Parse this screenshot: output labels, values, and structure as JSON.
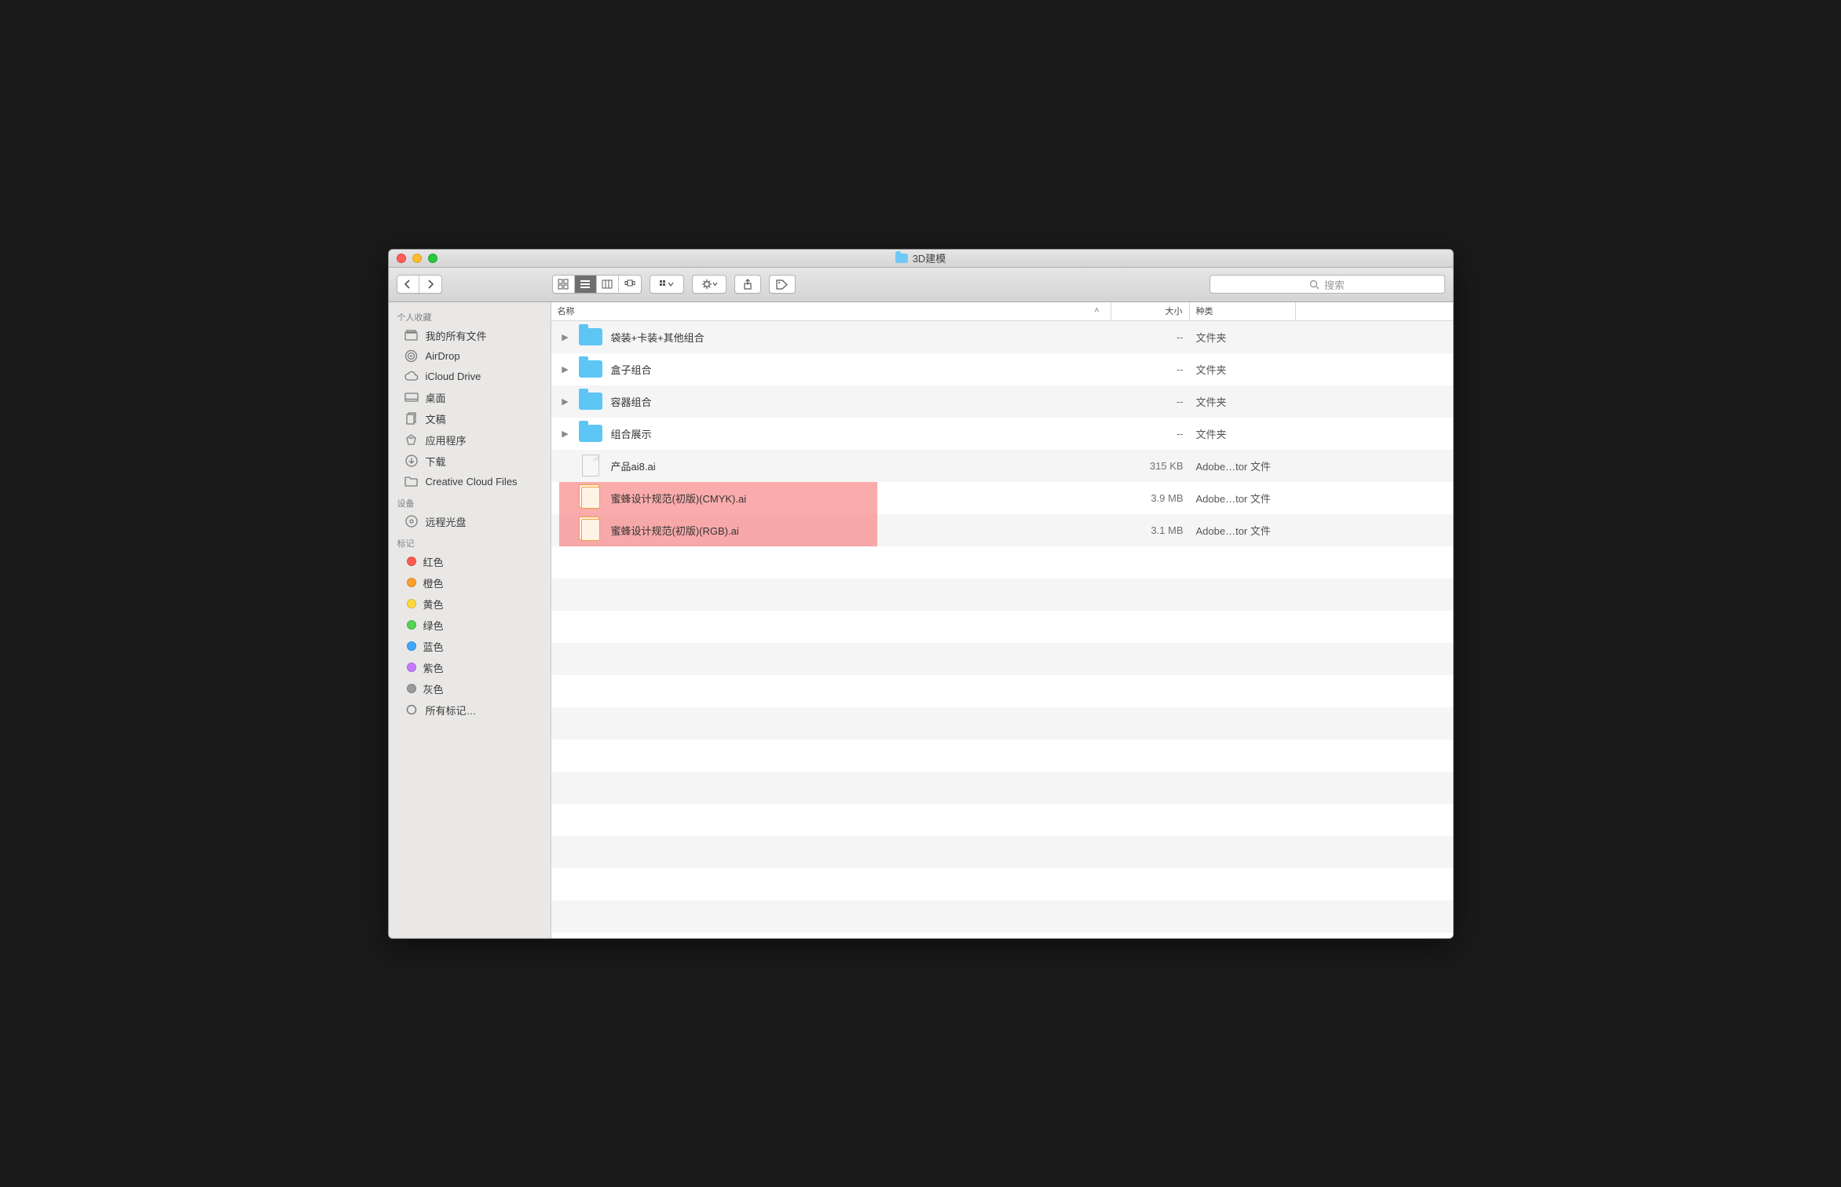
{
  "window": {
    "title": "3D建模"
  },
  "search": {
    "placeholder": "搜索"
  },
  "sidebar": {
    "groups": [
      {
        "label": "个人收藏",
        "items": [
          {
            "label": "我的所有文件"
          },
          {
            "label": "AirDrop"
          },
          {
            "label": "iCloud Drive"
          },
          {
            "label": "桌面"
          },
          {
            "label": "文稿"
          },
          {
            "label": "应用程序"
          },
          {
            "label": "下载"
          },
          {
            "label": "Creative Cloud Files"
          }
        ]
      },
      {
        "label": "设备",
        "items": [
          {
            "label": "远程光盘"
          }
        ]
      },
      {
        "label": "标记",
        "items": [
          {
            "label": "红色",
            "color": "#ff5b4f"
          },
          {
            "label": "橙色",
            "color": "#ff9e2c"
          },
          {
            "label": "黄色",
            "color": "#ffd93b"
          },
          {
            "label": "绿色",
            "color": "#54d454"
          },
          {
            "label": "蓝色",
            "color": "#3ea7ff"
          },
          {
            "label": "紫色",
            "color": "#c57bff"
          },
          {
            "label": "灰色",
            "color": "#9b9b9b"
          },
          {
            "label": "所有标记…",
            "color": null
          }
        ]
      }
    ]
  },
  "columns": {
    "name": "名称",
    "size": "大小",
    "kind": "种类"
  },
  "rows": [
    {
      "name": "袋装+卡装+其他组合",
      "size": "--",
      "kind": "文件夹",
      "type": "folder"
    },
    {
      "name": "盒子组合",
      "size": "--",
      "kind": "文件夹",
      "type": "folder"
    },
    {
      "name": "容器组合",
      "size": "--",
      "kind": "文件夹",
      "type": "folder"
    },
    {
      "name": "组合展示",
      "size": "--",
      "kind": "文件夹",
      "type": "folder"
    },
    {
      "name": "产品ai8.ai",
      "size": "315 KB",
      "kind": "Adobe…tor 文件",
      "type": "doc"
    },
    {
      "name": "蜜蜂设计规范(初版)(CMYK).ai",
      "size": "3.9 MB",
      "kind": "Adobe…tor 文件",
      "type": "ai",
      "highlight": true
    },
    {
      "name": "蜜蜂设计规范(初版)(RGB).ai",
      "size": "3.1 MB",
      "kind": "Adobe…tor 文件",
      "type": "ai",
      "highlight": true
    }
  ]
}
